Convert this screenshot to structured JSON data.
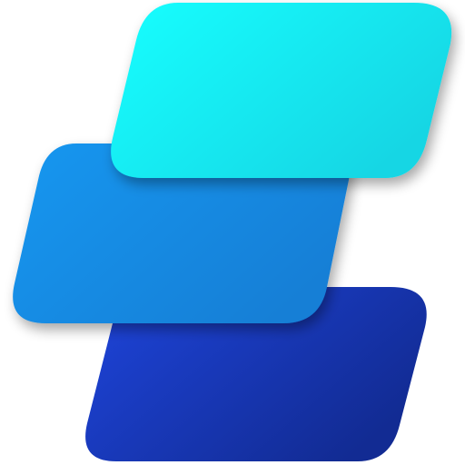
{
  "logo": {
    "icon": "stacked-parallelogram-layers-icon",
    "colors": {
      "top_start": "#16FFFF",
      "top_end": "#12D6E4",
      "middle_start": "#1597F0",
      "middle_end": "#137FD6",
      "bottom_start": "#1E45DC",
      "bottom_end": "#122B93"
    }
  }
}
